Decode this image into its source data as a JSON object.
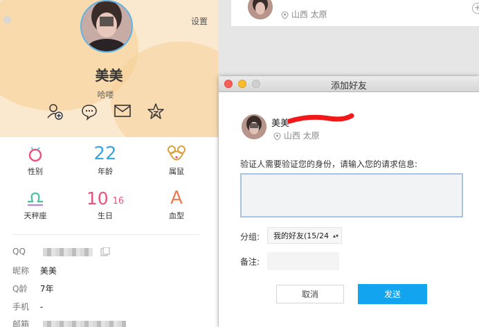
{
  "profile": {
    "settings_label": "设置",
    "name": "美美",
    "signature": "哈喽",
    "actions": [
      {
        "icon": "add-friend-icon"
      },
      {
        "icon": "chat-icon"
      },
      {
        "icon": "mail-icon"
      },
      {
        "icon": "star-icon"
      }
    ],
    "attributes": [
      {
        "icon": "gender-icon",
        "value": "",
        "label": "性别"
      },
      {
        "icon": "age-number",
        "value": "22",
        "label": "年龄"
      },
      {
        "icon": "zodiac-rat-icon",
        "value": "",
        "label": "属鼠"
      },
      {
        "icon": "libra-icon",
        "value": "♎",
        "label": "天秤座"
      },
      {
        "icon": "birthday-date",
        "value": "10",
        "value2": "16",
        "label": "生日"
      },
      {
        "icon": "blood-type-icon",
        "value": "A",
        "label": "血型"
      }
    ],
    "info": {
      "qq_label": "QQ",
      "nickname_label": "昵称",
      "nickname_value": "美美",
      "qage_label": "Q龄",
      "qage_value": "7年",
      "phone_label": "手机",
      "phone_value": "-",
      "email_label": "邮箱"
    }
  },
  "top_card": {
    "location": "山西 太原"
  },
  "dialog": {
    "title": "添加好友",
    "user_name": "美美",
    "location": "山西 太原",
    "prompt": "验证人需要验证您的身份，请输入您的请求信息:",
    "group_label": "分组:",
    "group_value": "我的好友(15/24",
    "remark_label": "备注:",
    "cancel_label": "取消",
    "send_label": "发送"
  },
  "colors": {
    "accent": "#12a4ef",
    "close_dot": "#fc5f57",
    "minimize_dot": "#fdbc2e",
    "zoom_dot": "#d0d0d0"
  }
}
